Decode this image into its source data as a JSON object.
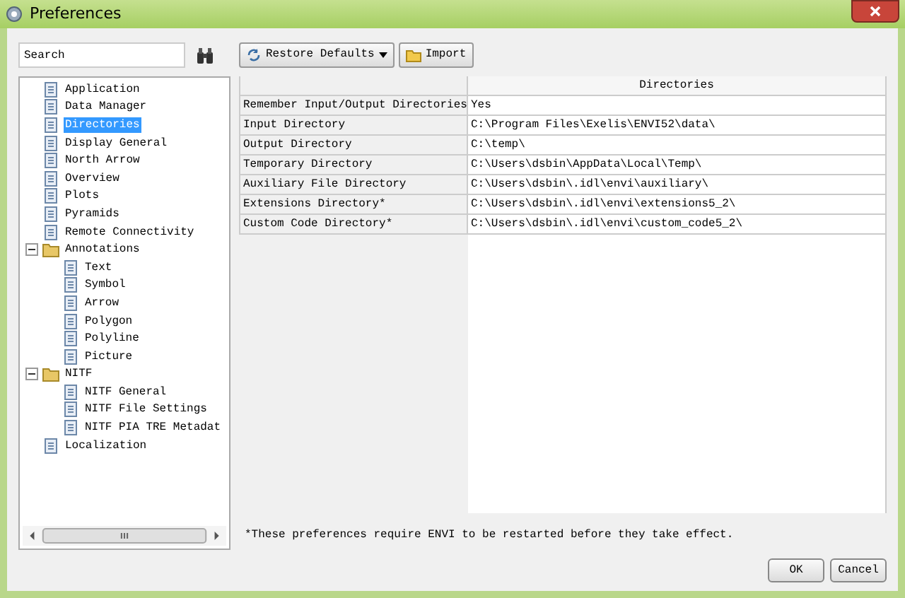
{
  "window": {
    "title": "Preferences"
  },
  "search": {
    "placeholder": "Search"
  },
  "tree": {
    "items": [
      {
        "label": "Application",
        "selected": false
      },
      {
        "label": "Data Manager",
        "selected": false
      },
      {
        "label": "Directories",
        "selected": true
      },
      {
        "label": "Display General",
        "selected": false
      },
      {
        "label": "North Arrow",
        "selected": false
      },
      {
        "label": "Overview",
        "selected": false
      },
      {
        "label": "Plots",
        "selected": false
      },
      {
        "label": "Pyramids",
        "selected": false
      },
      {
        "label": "Remote Connectivity",
        "selected": false
      },
      {
        "label": "Annotations",
        "selected": false,
        "expanded": true,
        "children": [
          {
            "label": "Text",
            "selected": false
          },
          {
            "label": "Symbol",
            "selected": false
          },
          {
            "label": "Arrow",
            "selected": false
          },
          {
            "label": "Polygon",
            "selected": false
          },
          {
            "label": "Polyline",
            "selected": false
          },
          {
            "label": "Picture",
            "selected": false
          }
        ]
      },
      {
        "label": "NITF",
        "selected": false,
        "expanded": true,
        "children": [
          {
            "label": "NITF General",
            "selected": false
          },
          {
            "label": "NITF File Settings",
            "selected": false
          },
          {
            "label": "NITF PIA TRE Metadat",
            "selected": false
          }
        ]
      },
      {
        "label": "Localization",
        "selected": false
      }
    ]
  },
  "toolbar": {
    "buttons": [
      {
        "label": "Restore Defaults",
        "kind": "dropdown"
      },
      {
        "label": "Import",
        "kind": "folder"
      }
    ]
  },
  "table": {
    "columns": [
      "Directories"
    ],
    "rows": [
      {
        "name": "Remember Input/Output Directories",
        "value": "Yes"
      },
      {
        "name": "Input Directory",
        "value": "C:\\Program Files\\Exelis\\ENVI52\\data\\"
      },
      {
        "name": "Output Directory",
        "value": "C:\\temp\\"
      },
      {
        "name": "Temporary Directory",
        "value": "C:\\Users\\dsbin\\AppData\\Local\\Temp\\"
      },
      {
        "name": "Auxiliary File Directory",
        "value": "C:\\Users\\dsbin\\.idl\\envi\\auxiliary\\"
      },
      {
        "name": "Extensions Directory*",
        "value": "C:\\Users\\dsbin\\.idl\\envi\\extensions5_2\\"
      },
      {
        "name": "Custom Code Directory*",
        "value": "C:\\Users\\dsbin\\.idl\\envi\\custom_code5_2\\"
      }
    ]
  },
  "footnote": "*These preferences require ENVI to be restarted before they take effect.",
  "buttons": [
    "OK",
    "Cancel"
  ]
}
